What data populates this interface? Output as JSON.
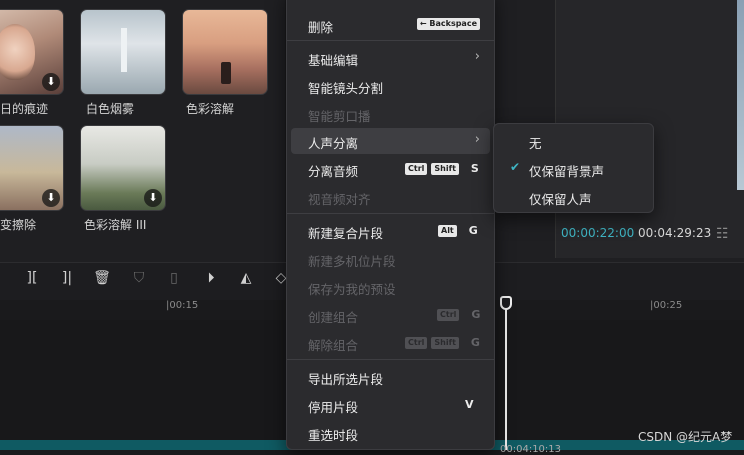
{
  "library": {
    "items": [
      {
        "label": "日的痕迹"
      },
      {
        "label": "白色烟雾"
      },
      {
        "label": "色彩溶解"
      },
      {
        "label": "变擦除"
      },
      {
        "label": "色彩溶解 III"
      }
    ],
    "download_glyph": "⬇"
  },
  "player": {
    "current_time": "00:00:22:00",
    "total_time": "00:04:29:23"
  },
  "toolbar": {
    "icons": [
      "split-left-icon",
      "split-right-icon",
      "delete-icon",
      "shield-icon",
      "freeze-frame-icon",
      "play-reverse-icon",
      "mirror-icon",
      "rotate-icon"
    ]
  },
  "timeline": {
    "ruler_labels": [
      "|00:15",
      "|00:25"
    ],
    "below_time": "00:04:10:13"
  },
  "context_menu": {
    "items": [
      {
        "label": "删除",
        "shortcut": "← Backspace"
      },
      {
        "label": "基础编辑",
        "has_submenu": true
      },
      {
        "label": "智能镜头分割"
      },
      {
        "label": "智能剪口播",
        "disabled": true
      },
      {
        "label": "人声分离",
        "has_submenu": true,
        "highlighted": true
      },
      {
        "label": "分离音频",
        "keys": [
          "Ctrl",
          "Shift"
        ],
        "key_letter": "S"
      },
      {
        "label": "视音频对齐",
        "disabled": true
      },
      {
        "label": "新建复合片段",
        "keys": [
          "Alt"
        ],
        "key_letter": "G"
      },
      {
        "label": "新建多机位片段",
        "disabled": true
      },
      {
        "label": "保存为我的预设",
        "disabled": true
      },
      {
        "label": "创建组合",
        "disabled": true,
        "keys": [
          "Ctrl"
        ],
        "key_letter": "G"
      },
      {
        "label": "解除组合",
        "disabled": true,
        "keys": [
          "Ctrl",
          "Shift"
        ],
        "key_letter": "G"
      },
      {
        "label": "导出所选片段"
      },
      {
        "label": "停用片段",
        "key_letter": "V"
      },
      {
        "label": "重选时段"
      }
    ]
  },
  "submenu": {
    "items": [
      {
        "label": "无",
        "checked": false
      },
      {
        "label": "仅保留背景声",
        "checked": true
      },
      {
        "label": "仅保留人声",
        "checked": false
      }
    ]
  },
  "watermark": "CSDN @纪元A梦",
  "colors": {
    "accent": "#3fb5c4",
    "menu_bg": "#2b2b2e",
    "highlight": "#3e3e42"
  }
}
